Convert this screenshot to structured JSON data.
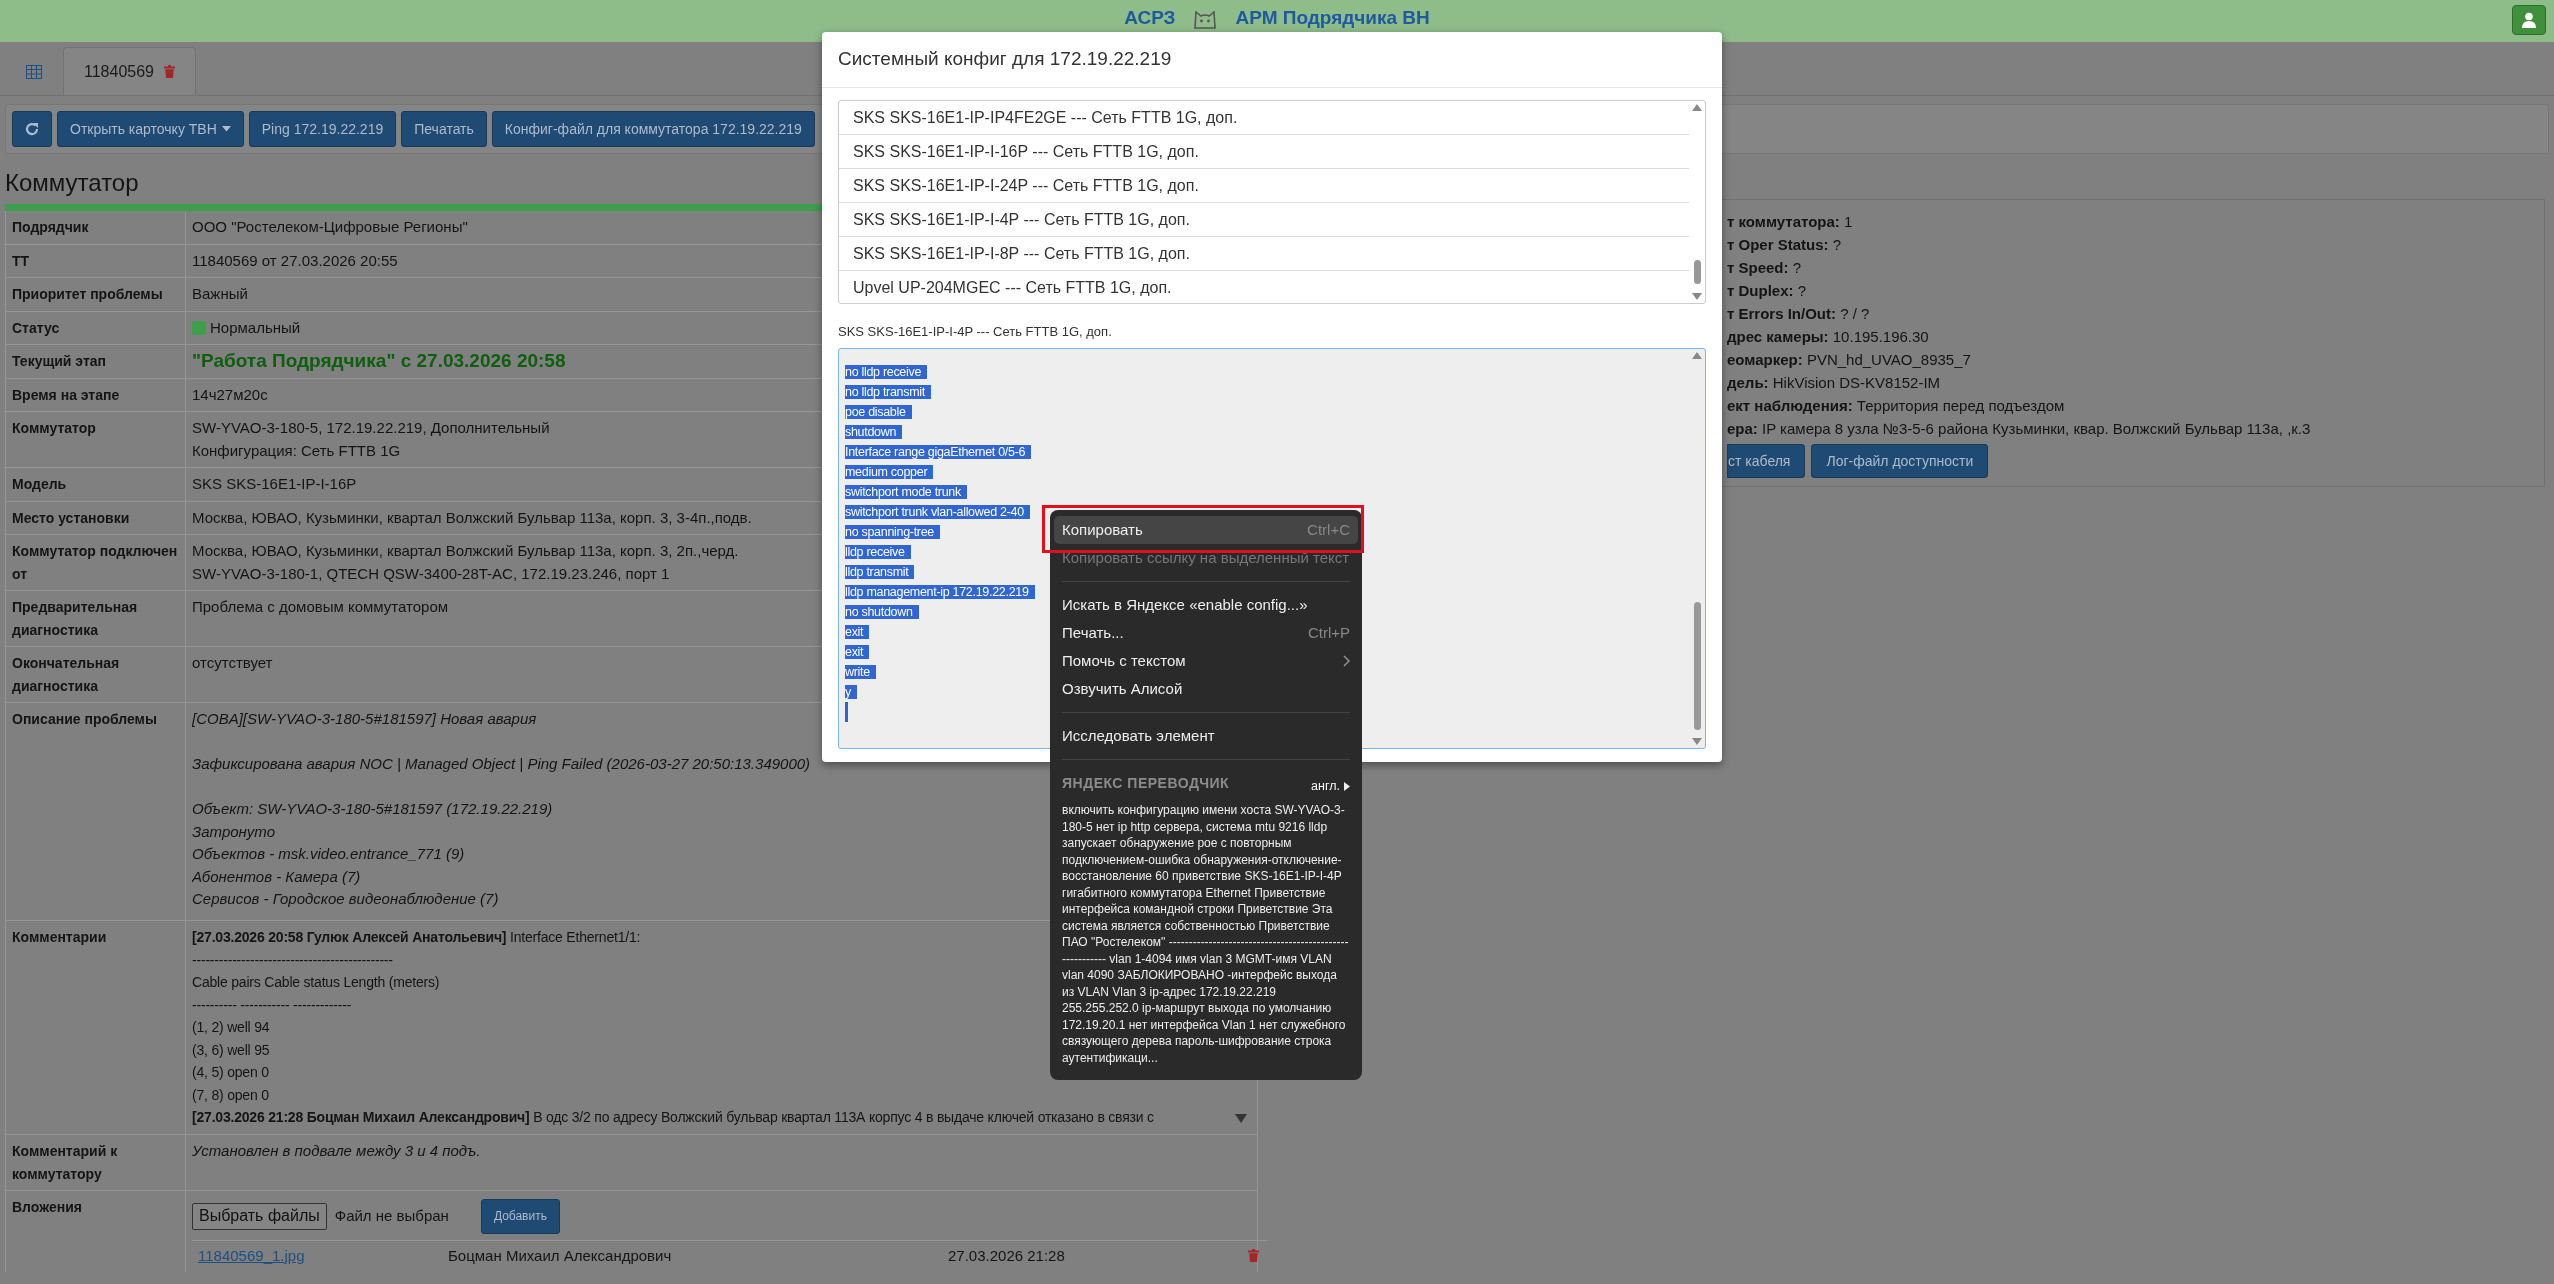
{
  "navbar": {
    "brand": "АСРЗ",
    "title": "АРМ Подрядчика ВН"
  },
  "tabs": [
    {
      "kind": "grid",
      "selected": false
    },
    {
      "kind": "ticket",
      "label": "11840569",
      "selected": true
    }
  ],
  "toolbar": [
    {
      "kind": "refresh"
    },
    {
      "kind": "dropdown",
      "label": "Открыть карточку ТВН"
    },
    {
      "kind": "button",
      "label": "Ping 172.19.22.219"
    },
    {
      "kind": "button",
      "label": "Печатать"
    },
    {
      "kind": "button",
      "label": "Конфиг-файл для коммутатора 172.19.22.219"
    }
  ],
  "section_title": "Коммутатор",
  "details": [
    {
      "kind": "text",
      "label": "Подрядчик",
      "lines": [
        "ООО \"Ростелеком-Цифровые Регионы\""
      ]
    },
    {
      "kind": "text",
      "label": "ТТ",
      "lines": [
        "11840569 от 27.03.2026 20:55"
      ]
    },
    {
      "kind": "text",
      "label": "Приоритет проблемы",
      "lines": [
        "Важный"
      ]
    },
    {
      "kind": "status",
      "label": "Статус",
      "lines": [
        "Нормальный"
      ],
      "color": "#3f9e4c"
    },
    {
      "kind": "stage",
      "label": "Текущий этап",
      "lines": [
        "\"Работа Подрядчика\" с 27.03.2026 20:58"
      ]
    },
    {
      "kind": "text",
      "label": "Время на этапе",
      "lines": [
        "14ч27м20с"
      ]
    },
    {
      "kind": "text",
      "label": "Коммутатор",
      "lines": [
        "SW-YVAO-3-180-5, 172.19.22.219, Дополнительный",
        "Конфигурация: Сеть FTTB 1G"
      ]
    },
    {
      "kind": "text",
      "label": "Модель",
      "lines": [
        "SKS SKS-16E1-IP-I-16P"
      ]
    },
    {
      "kind": "text",
      "label": "Место установки",
      "lines": [
        "Москва, ЮВАО, Кузьминки, квартал Волжский Бульвар 113а, корп. 3, 3-4п.,подв."
      ]
    },
    {
      "kind": "text",
      "label": "Коммутатор подключен от",
      "lines": [
        "Москва, ЮВАО, Кузьминки, квартал Волжский Бульвар 113а, корп. 3, 2п.,черд.",
        "SW-YVAO-3-180-1, QTECH QSW-3400-28T-AC, 172.19.23.246, порт 1"
      ]
    },
    {
      "kind": "text",
      "label": "Предварительная диагностика",
      "lines": [
        "Проблема с домовым коммутатором"
      ]
    },
    {
      "kind": "text",
      "label": "Окончательная диагностика",
      "lines": [
        "отсутствует"
      ]
    },
    {
      "kind": "description",
      "label": "Описание проблемы",
      "paragraphs": [
        [
          "[COBA][SW-YVAO-3-180-5#181597] Новая авария"
        ],
        [
          "Зафиксирована авария NOC | Managed Object | Ping Failed (2026-03-27 20:50:13.349000)"
        ],
        [
          "Объект: SW-YVAO-3-180-5#181597 (172.19.22.219)",
          "Затронуто",
          "Объектов - msk.video.entrance_771 (9)",
          "Абонентов - Камера (7)",
          "Сервисов - Городское видеонаблюдение (7)"
        ]
      ]
    },
    {
      "kind": "comments",
      "label": "Комментарии",
      "lines": [
        "**[27.03.2026 20:58 Гулюк Алексей Анатольевич]** Interface Ethernet1/1:",
        "---------------------------------------------",
        "Cable pairs Cable status Length (meters)",
        "---------- ----------- -------------",
        "(1, 2) well 94",
        "(3, 6) well 95",
        "(4, 5) open 0",
        "(7, 8) open 0",
        "**[27.03.2026 21:28 Боцман Михаил Александрович]** В одс 3/2 по адресу Волжский бульвар квартал 113А корпус 4 в выдаче ключей отказано в связи с"
      ]
    },
    {
      "kind": "note",
      "label": "Комментарий к коммутатору",
      "lines": [
        "Установлен в подвале между 3 и 4 подъ."
      ]
    },
    {
      "kind": "attachments",
      "label": "Вложения",
      "file_button": "Выбрать файлы",
      "file_status": "Файл не выбран",
      "add_button": "Добавить",
      "files": [
        {
          "name": "11840569_1.jpg",
          "author": "Боцман Михаил Александрович",
          "date": "27.03.2026 21:28"
        }
      ]
    }
  ],
  "camera_panel": {
    "lines": [
      "**т коммутатора:** 1",
      "**т Oper Status:** ?",
      "**т Speed:** ?",
      "**т Duplex:** ?",
      "**т Errors In/Out:** ? / ?",
      "**дрес камеры:** 10.195.196.30",
      "**еомаркер:** PVN_hd_UVAO_8935_7",
      "**дель:** HikVision DS-KV8152-IM",
      "**ект наблюдения:** Территория перед подъездом",
      "**ера:** IP камера 8 узла №3-5-6 района Кузьминки, квар. Волжский Бульвар 113а, ,к.3"
    ],
    "buttons": [
      "ст кабеля",
      "Лог-файл доступности"
    ]
  },
  "modal": {
    "title": "Системный конфиг для 172.19.22.219",
    "options": [
      "SKS SKS-16E1-IP-IP4FE2GE --- Сеть FTTB 1G, доп.",
      "SKS SKS-16E1-IP-I-16P --- Сеть FTTB 1G, доп.",
      "SKS SKS-16E1-IP-I-24P --- Сеть FTTB 1G, доп.",
      "SKS SKS-16E1-IP-I-4P --- Сеть FTTB 1G, доп.",
      "SKS SKS-16E1-IP-I-8P --- Сеть FTTB 1G, доп.",
      "Upvel UP-204MGEC --- Сеть FTTB 1G, доп."
    ],
    "config_label": "SKS SKS-16E1-IP-I-4P --- Сеть FTTB 1G, доп.",
    "config_lines": [
      "no lldp receive",
      "no lldp transmit",
      "poe disable",
      "shutdown",
      "Interface range gigaEthernet 0/5-6",
      "medium copper",
      "switchport mode trunk",
      "switchport trunk vlan-allowed 2-40",
      "no spanning-tree",
      "lldp receive",
      "lldp transmit",
      "lldp management-ip 172.19.22.219",
      "no shutdown",
      "exit",
      "exit",
      "write",
      "y"
    ]
  },
  "context_menu": {
    "items": [
      {
        "kind": "item",
        "label": "Копировать",
        "shortcut": "Ctrl+C",
        "selected": true,
        "disabled": false
      },
      {
        "kind": "item",
        "label": "Копировать ссылку на выделенный текст",
        "selected": false,
        "disabled": true
      },
      {
        "kind": "divider"
      },
      {
        "kind": "item",
        "label": "Искать в Яндексе «enable config...»",
        "selected": false,
        "disabled": false
      },
      {
        "kind": "item",
        "label": "Печать...",
        "shortcut": "Ctrl+P",
        "selected": false,
        "disabled": false
      },
      {
        "kind": "submenu",
        "label": "Помочь с текстом",
        "selected": false,
        "disabled": false
      },
      {
        "kind": "item",
        "label": "Озвучить Алисой",
        "selected": false,
        "disabled": false
      },
      {
        "kind": "divider"
      },
      {
        "kind": "item",
        "label": "Исследовать элемент",
        "selected": false,
        "disabled": false
      },
      {
        "kind": "divider"
      }
    ],
    "translator": {
      "title": "ЯНДЕКС ПЕРЕВОДЧИК",
      "language": "англ.",
      "text": "включить конфигурацию имени хоста SW-YVAO-3-180-5 нет ip http сервера, система mtu 9216 lldp запускает обнаружение рое с повторным подключением-ошибка обнаружения-отключение-восстановление 60 приветствие SKS-16E1-IP-I-4P гигабитного коммутатора Ethernet Приветствие интерфейса командной строки Приветствие Эта система является собственностью Приветствие ПАО \"Ростелеком\" -------------------------------------------------------- vlan 1-4094 имя vlan 3 MGMT-имя VLAN vlan 4090 ЗАБЛОКИРОВАНО -интерфейс выхода из VLAN Vlan 3 ip-адрес 172.19.22.219 255.255.252.0 ip-маршрут выхода по умолчанию 172.19.20.1 нет интерфейса Vlan 1 нет служебного связующего дерева пароль-шифрование строка аутентификаци..."
    }
  }
}
